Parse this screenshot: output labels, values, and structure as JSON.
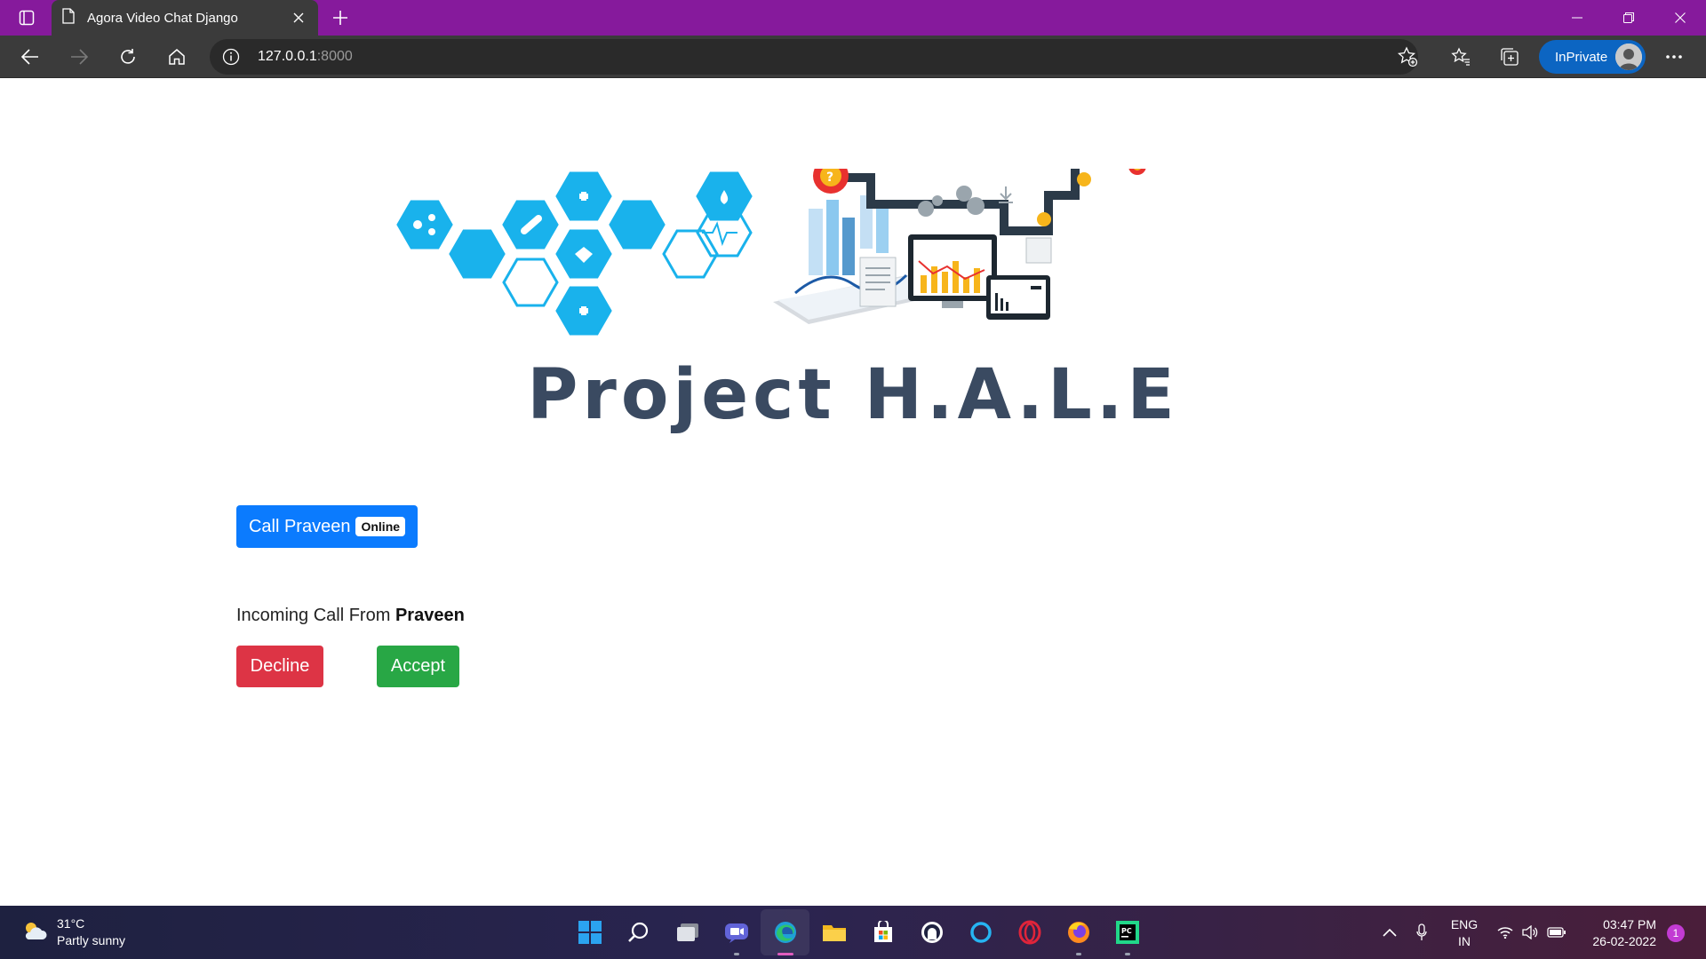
{
  "browser": {
    "tab": {
      "title": "Agora Video Chat Django",
      "close_icon": "close-icon"
    },
    "new_tab_icon": "plus-icon",
    "window_controls": [
      "minimize-icon",
      "restore-icon",
      "close-icon"
    ],
    "address": {
      "host": "127.0.0.1",
      "port": ":8000"
    },
    "inprivate_label": "InPrivate",
    "accent": "#861a9c"
  },
  "page": {
    "heading": "Project H.A.L.E",
    "call_button": {
      "label": "Call Praveen",
      "badge": "Online"
    },
    "incoming": {
      "prefix": "Incoming Call From",
      "caller": "Praveen"
    },
    "decline_label": "Decline",
    "accept_label": "Accept",
    "colors": {
      "primary": "#0b7bfe",
      "danger": "#dd3445",
      "success": "#28a745",
      "heading": "#3a4a61"
    }
  },
  "taskbar": {
    "weather": {
      "temp": "31°C",
      "condition": "Partly sunny"
    },
    "apps": [
      "windows-start",
      "search",
      "task-view",
      "teams-chat",
      "edge",
      "file-explorer",
      "microsoft-store",
      "github-desktop",
      "cortana",
      "opera",
      "firefox",
      "pycharm"
    ],
    "language": {
      "line1": "ENG",
      "line2": "IN"
    },
    "time": "03:47 PM",
    "date": "26-02-2022",
    "notification_count": "1"
  }
}
